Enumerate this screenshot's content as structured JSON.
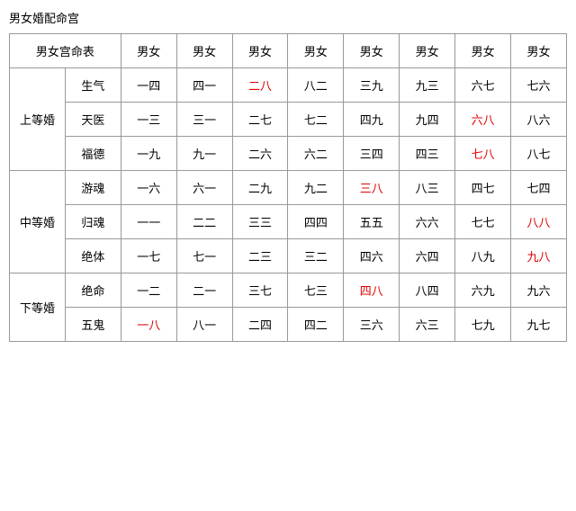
{
  "title": "男女婚配命宫",
  "table": {
    "header": {
      "col0": "男女宫命表",
      "cols": [
        "男女",
        "男女",
        "男女",
        "男女",
        "男女",
        "男女",
        "男女",
        "男女"
      ]
    },
    "groups": [
      {
        "groupLabel": "上等婚",
        "rows": [
          {
            "subLabel": "生气",
            "cells": [
              {
                "text": "一四",
                "red": false
              },
              {
                "text": "四一",
                "red": false
              },
              {
                "text": "二八",
                "red": true
              },
              {
                "text": "八二",
                "red": false
              },
              {
                "text": "三九",
                "red": false
              },
              {
                "text": "九三",
                "red": false
              },
              {
                "text": "六七",
                "red": false
              },
              {
                "text": "七六",
                "red": false
              }
            ]
          },
          {
            "subLabel": "天医",
            "cells": [
              {
                "text": "一三",
                "red": false
              },
              {
                "text": "三一",
                "red": false
              },
              {
                "text": "二七",
                "red": false
              },
              {
                "text": "七二",
                "red": false
              },
              {
                "text": "四九",
                "red": false
              },
              {
                "text": "九四",
                "red": false
              },
              {
                "text": "六八",
                "red": true
              },
              {
                "text": "八六",
                "red": false
              }
            ]
          },
          {
            "subLabel": "福德",
            "cells": [
              {
                "text": "一九",
                "red": false
              },
              {
                "text": "九一",
                "red": false
              },
              {
                "text": "二六",
                "red": false
              },
              {
                "text": "六二",
                "red": false
              },
              {
                "text": "三四",
                "red": false
              },
              {
                "text": "四三",
                "red": false
              },
              {
                "text": "七八",
                "red": true
              },
              {
                "text": "八七",
                "red": false
              }
            ]
          }
        ]
      },
      {
        "groupLabel": "中等婚",
        "rows": [
          {
            "subLabel": "游魂",
            "cells": [
              {
                "text": "一六",
                "red": false
              },
              {
                "text": "六一",
                "red": false
              },
              {
                "text": "二九",
                "red": false
              },
              {
                "text": "九二",
                "red": false
              },
              {
                "text": "三八",
                "red": true
              },
              {
                "text": "八三",
                "red": false
              },
              {
                "text": "四七",
                "red": false
              },
              {
                "text": "七四",
                "red": false
              }
            ]
          },
          {
            "subLabel": "归魂",
            "cells": [
              {
                "text": "一一",
                "red": false
              },
              {
                "text": "二二",
                "red": false
              },
              {
                "text": "三三",
                "red": false
              },
              {
                "text": "四四",
                "red": false
              },
              {
                "text": "五五",
                "red": false
              },
              {
                "text": "六六",
                "red": false
              },
              {
                "text": "七七",
                "red": false
              },
              {
                "text": "八八",
                "red": true
              }
            ]
          },
          {
            "subLabel": "绝体",
            "cells": [
              {
                "text": "一七",
                "red": false
              },
              {
                "text": "七一",
                "red": false
              },
              {
                "text": "二三",
                "red": false
              },
              {
                "text": "三二",
                "red": false
              },
              {
                "text": "四六",
                "red": false
              },
              {
                "text": "六四",
                "red": false
              },
              {
                "text": "八九",
                "red": false
              },
              {
                "text": "九八",
                "red": true
              }
            ]
          }
        ]
      },
      {
        "groupLabel": "下等婚",
        "rows": [
          {
            "subLabel": "绝命",
            "cells": [
              {
                "text": "一二",
                "red": false
              },
              {
                "text": "二一",
                "red": false
              },
              {
                "text": "三七",
                "red": false
              },
              {
                "text": "七三",
                "red": false
              },
              {
                "text": "四八",
                "red": true
              },
              {
                "text": "八四",
                "red": false
              },
              {
                "text": "六九",
                "red": false
              },
              {
                "text": "九六",
                "red": false
              }
            ]
          },
          {
            "subLabel": "五鬼",
            "cells": [
              {
                "text": "一八",
                "red": true
              },
              {
                "text": "八一",
                "red": false
              },
              {
                "text": "二四",
                "red": false
              },
              {
                "text": "四二",
                "red": false
              },
              {
                "text": "三六",
                "red": false
              },
              {
                "text": "六三",
                "red": false
              },
              {
                "text": "七九",
                "red": false
              },
              {
                "text": "九七",
                "red": false
              }
            ]
          }
        ]
      }
    ]
  }
}
